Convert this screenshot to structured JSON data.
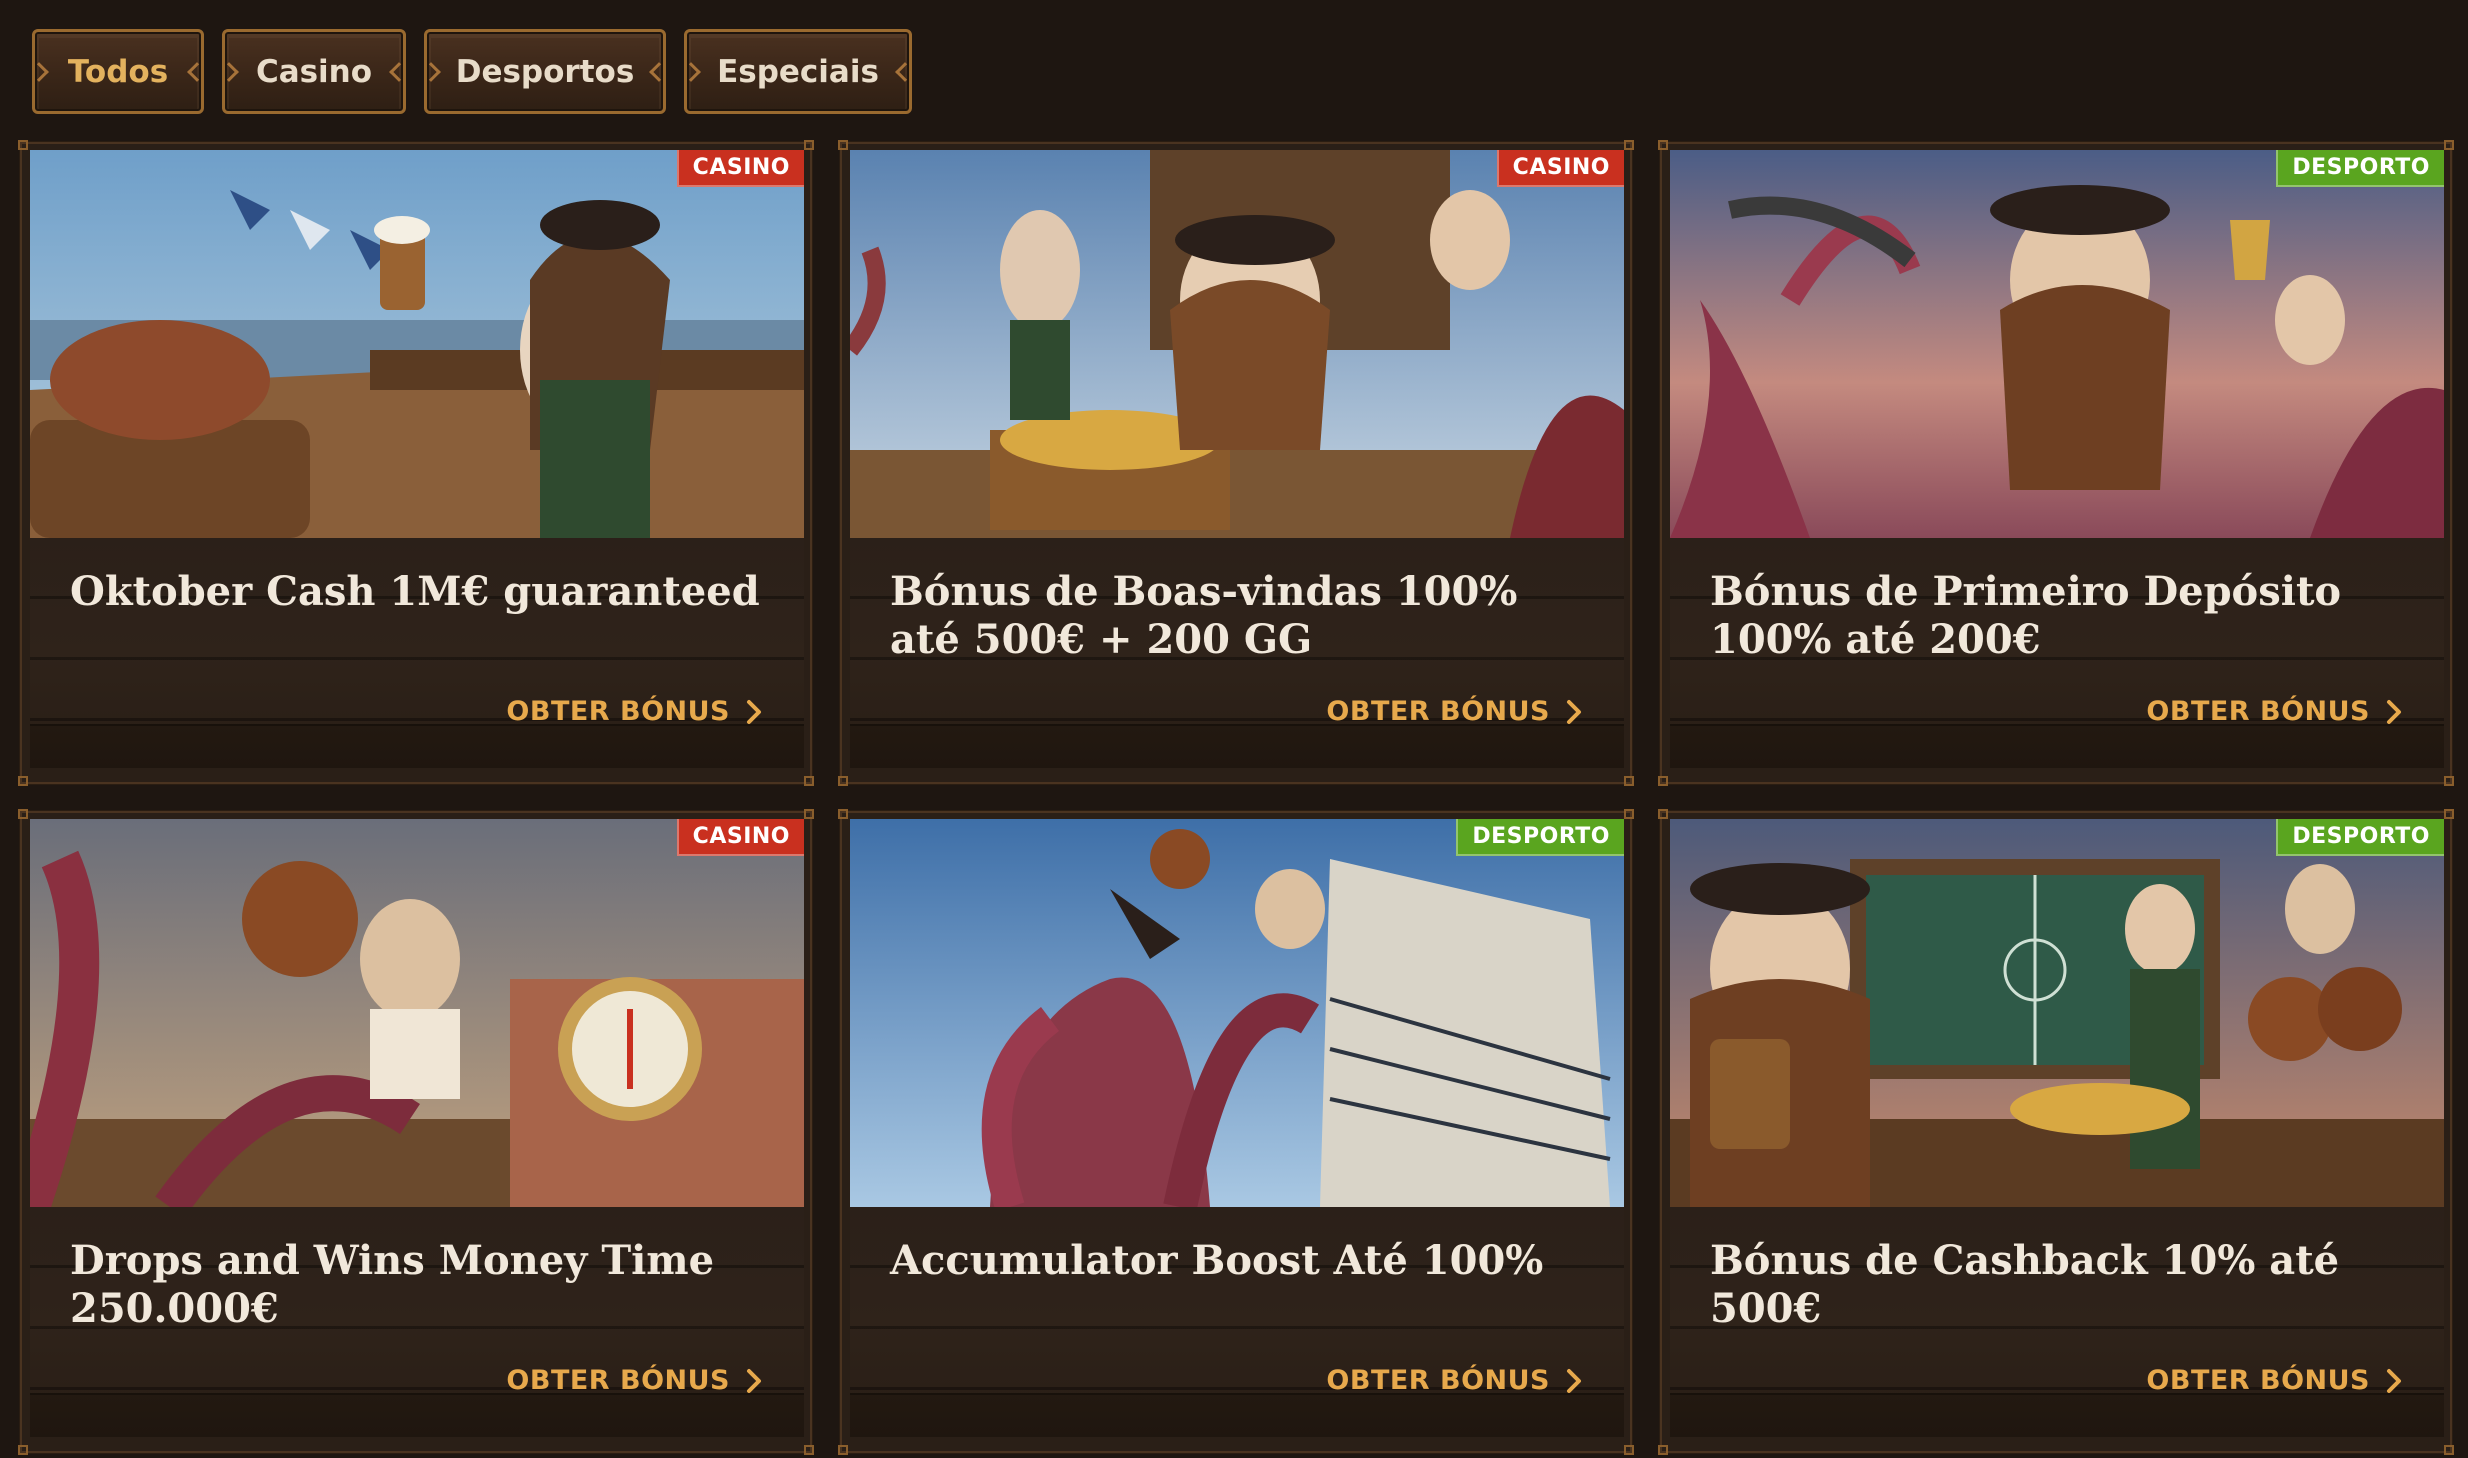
{
  "filters": {
    "tabs": [
      {
        "label": "Todos",
        "active": true
      },
      {
        "label": "Casino",
        "active": false
      },
      {
        "label": "Desportos",
        "active": false
      },
      {
        "label": "Especiais",
        "active": false
      }
    ]
  },
  "colors": {
    "background": "#1e1611",
    "accent": "#e7a94c",
    "casino_badge": "#c9301f",
    "sport_badge": "#5aa51f"
  },
  "promotions": [
    {
      "badge": "CASINO",
      "category": "casino",
      "title": "Oktober Cash 1M€ guaranteed",
      "cta": "OBTER BÓNUS",
      "image": "pirate-woman-beer-oktoberfest"
    },
    {
      "badge": "CASINO",
      "category": "casino",
      "title": "Bónus de Boas-vindas 100% até 500€ + 200 GG",
      "cta": "OBTER BÓNUS",
      "image": "pirate-captain-throne-treasure"
    },
    {
      "badge": "DESPORTO",
      "category": "sport",
      "title": "Bónus de Primeiro Depósito 100% até 200€",
      "cta": "OBTER BÓNUS",
      "image": "pirate-captain-trophy-kraken"
    },
    {
      "badge": "CASINO",
      "category": "casino",
      "title": "Drops and Wins Money Time 250.000€",
      "cta": "OBTER BÓNUS",
      "image": "pirate-football-compass-kraken"
    },
    {
      "badge": "DESPORTO",
      "category": "sport",
      "title": "Accumulator Boost Até 100%",
      "cta": "OBTER BÓNUS",
      "image": "pirate-kraken-bicycle-kick"
    },
    {
      "badge": "DESPORTO",
      "category": "sport",
      "title": "Bónus de Cashback 10% até 500€",
      "cta": "OBTER BÓNUS",
      "image": "pirates-tactics-board-footballs"
    }
  ]
}
